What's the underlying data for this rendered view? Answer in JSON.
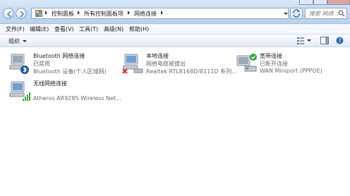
{
  "address_bar": {
    "crumbs": [
      "控制面板",
      "所有控制面板项",
      "网络连接"
    ]
  },
  "search": {
    "placeholder": "搜索 网络..."
  },
  "menu": [
    "文件(F)",
    "编辑(E)",
    "查看(V)",
    "工具(T)",
    "高级(N)",
    "帮助(H)"
  ],
  "toolbar": {
    "organize_label": "组织"
  },
  "connections": [
    {
      "name": "Bluetooth 网络连接",
      "status": "已禁用",
      "device": "Bluetooth 设备(个人区域网)",
      "icon": "bluetooth-network-icon"
    },
    {
      "name": "本地连接",
      "status": "网络电缆被拔出",
      "device": "Realtek RTL8168D/8111D 系列...",
      "icon": "ethernet-disconnected-icon"
    },
    {
      "name": "宽带连接",
      "status": "已断开连接",
      "device": "WAN Miniport (PPPOE)",
      "icon": "broadband-icon"
    },
    {
      "name": "无线网络连接",
      "status": "",
      "device": "Atheros AR9285 Wireless Net...",
      "icon": "wireless-network-icon"
    }
  ],
  "colors": {
    "accent": "#c2d9f1",
    "menu_bg": "#f4f7fc",
    "secondary_text": "#6d6d6d"
  }
}
